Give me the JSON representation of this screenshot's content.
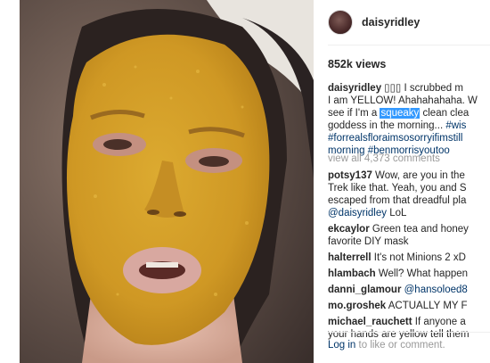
{
  "post": {
    "username": "daisyridley",
    "views": "852k views"
  },
  "caption": {
    "author": "daisyridley",
    "line1_text": " ▯▯▯ I scrubbed m",
    "line2": "I am YELLOW! Ahahahahaha. W",
    "line3_pre": "see if I'm a ",
    "line3_highlight": "squeaky",
    "line3_post": " clean clea",
    "line4_text": "goddess in the morning... ",
    "line4_tag": "#wis",
    "line5": "#forrealsfloraimsosorryifimstill",
    "line6_pre": "morning ",
    "line6_tag": "#benmorrisyoutoo"
  },
  "view_all": "view all 4,373 comments",
  "comments": [
    {
      "user": "potsy137",
      "lines": [
        " Wow, are you in the",
        "Trek like that. Yeah, you and S",
        "escaped from that dreadful pla",
        ""
      ],
      "mention": "@daisyridley",
      "after_mention": " LoL"
    },
    {
      "user": "ekcaylor",
      "lines": [
        " Green tea and honey",
        "favorite DIY mask"
      ]
    },
    {
      "user": "halterrell",
      "lines": [
        " It's not Minions 2 xD"
      ]
    },
    {
      "user": "hlambach",
      "lines": [
        " Well? What happen"
      ]
    },
    {
      "user": "danni_glamour",
      "mention_inline": " @hansoloed8"
    },
    {
      "user": "mo.groshek",
      "lines": [
        " ACTUALLY MY F"
      ]
    },
    {
      "user": "michael_rauchett",
      "lines": [
        " If anyone a",
        "your hands are yellow tell them"
      ]
    }
  ],
  "login": {
    "link": "Log in",
    "text": " to like or comment."
  },
  "colors": {
    "username": "#262626",
    "hashtag": "#003569",
    "muted": "#999999",
    "highlight": "#3399ff",
    "mask_yellow": "#d6a028"
  }
}
